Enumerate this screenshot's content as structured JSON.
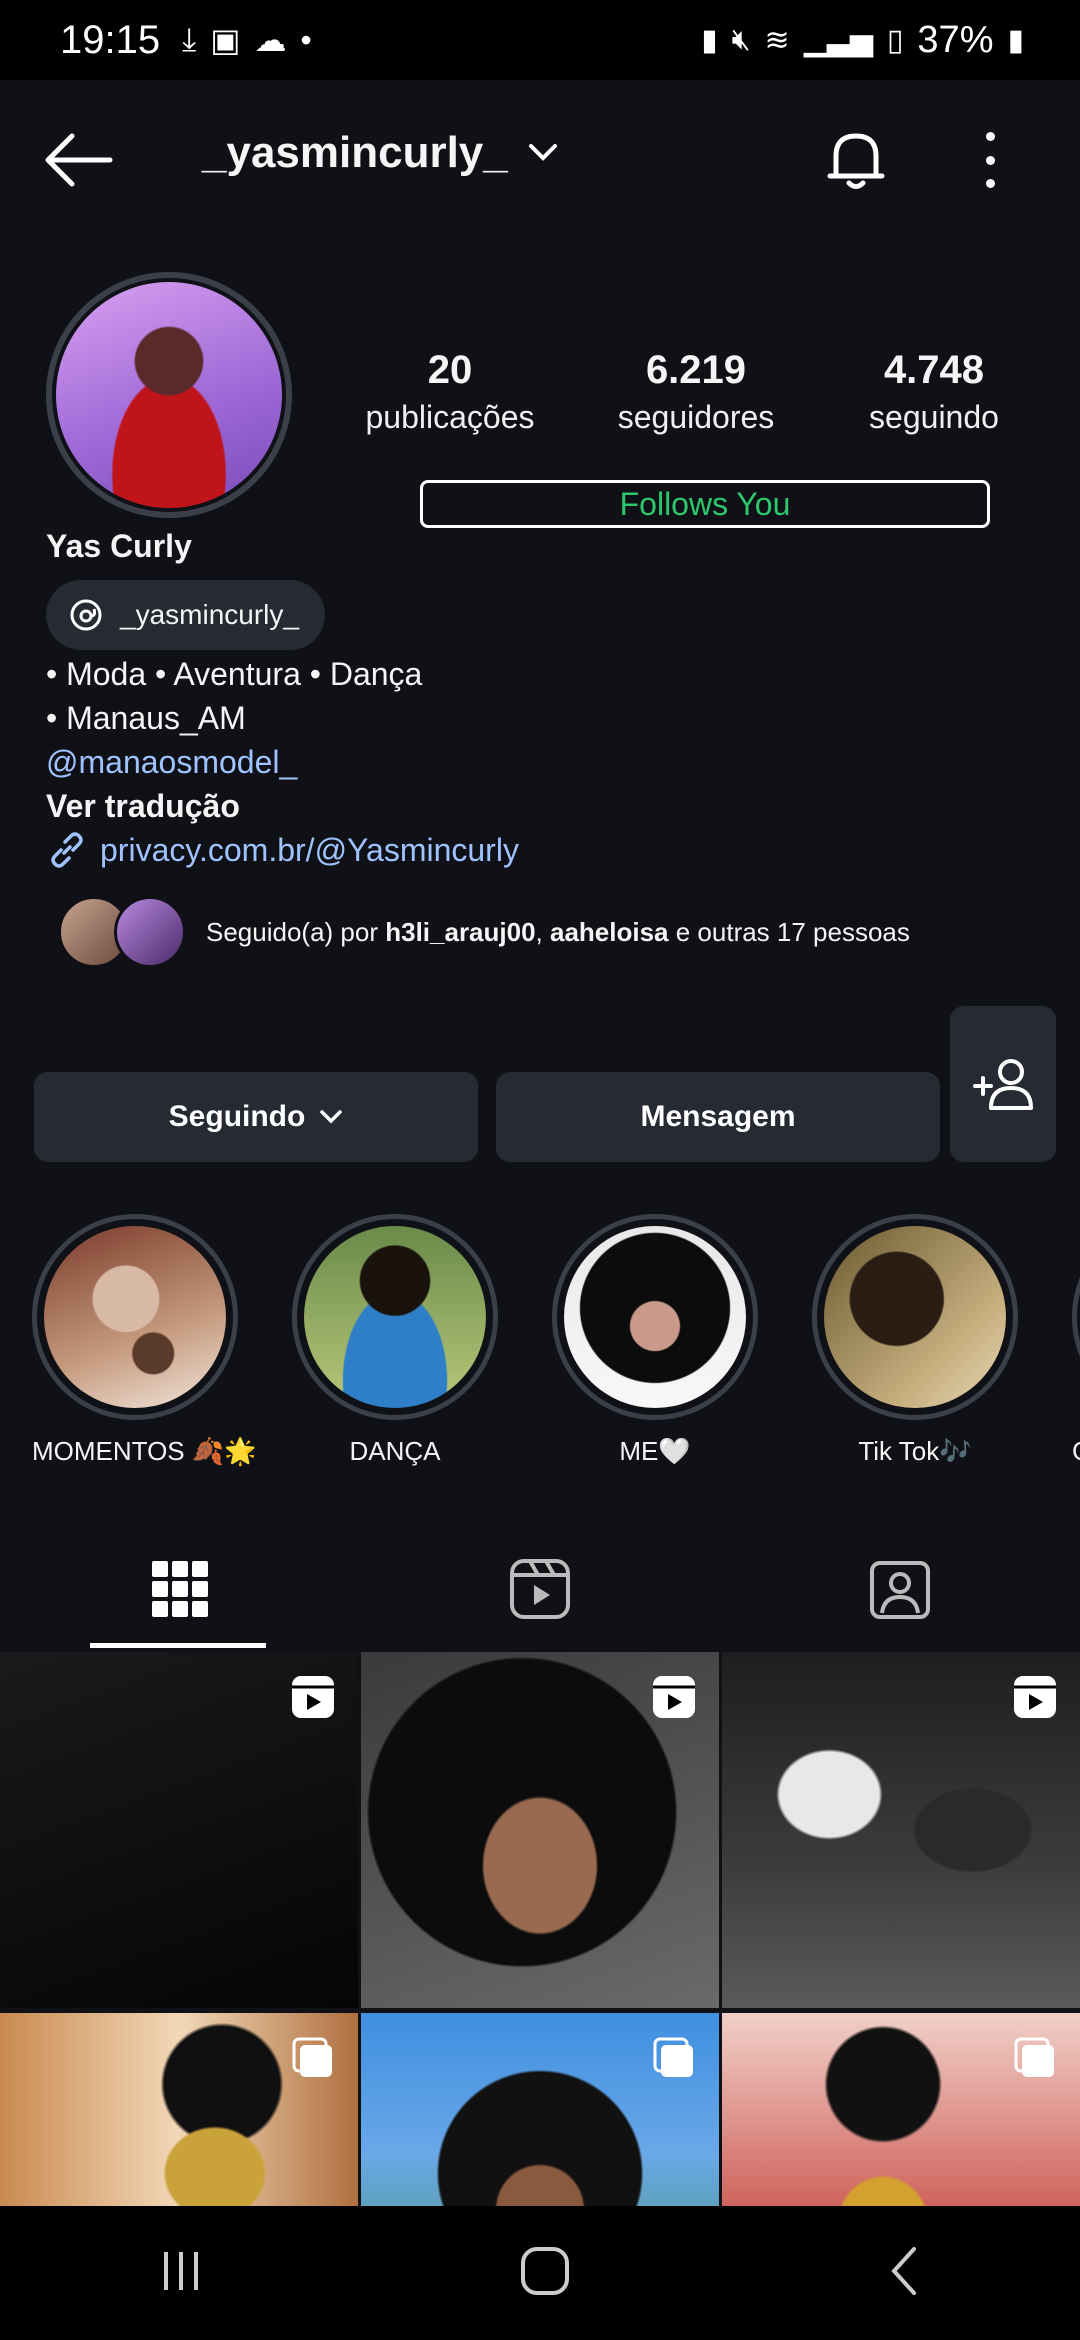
{
  "status_bar": {
    "time": "19:15",
    "battery": "37%"
  },
  "header": {
    "username": "_yasmincurly_"
  },
  "profile": {
    "stats": [
      {
        "value": "20",
        "label": "publicações"
      },
      {
        "value": "6.219",
        "label": "seguidores"
      },
      {
        "value": "4.748",
        "label": "seguindo"
      }
    ],
    "follows_you": "Follows You",
    "display_name": "Yas Curly",
    "threads_handle": "_yasmincurly_",
    "bio": {
      "line1": "• Moda • Aventura • Dança",
      "line2": "• Manaus_AM",
      "mention": "@manaosmodel_",
      "translate": "Ver tradução",
      "link": "privacy.com.br/@Yasmincurly"
    },
    "followed_by": {
      "prefix": "Seguido(a) por ",
      "user1": "h3li_arauj00",
      "sep": ", ",
      "user2": "aaheloisa",
      "suffix": " e outras 17 pessoas"
    }
  },
  "actions": {
    "following": "Seguindo",
    "message": "Mensagem"
  },
  "highlights": [
    {
      "label": "MOMENTOS 🍂🌟"
    },
    {
      "label": "DANÇA"
    },
    {
      "label": "ME🤍"
    },
    {
      "label": "Tik Tok🎶"
    },
    {
      "label": "G"
    }
  ],
  "tabs": [
    "grid-icon",
    "reels-icon",
    "tagged-icon"
  ],
  "colors": {
    "background": "#0f1116",
    "button": "#262a33",
    "link": "#9fc3ff",
    "follows_you": "#2fc76b"
  }
}
